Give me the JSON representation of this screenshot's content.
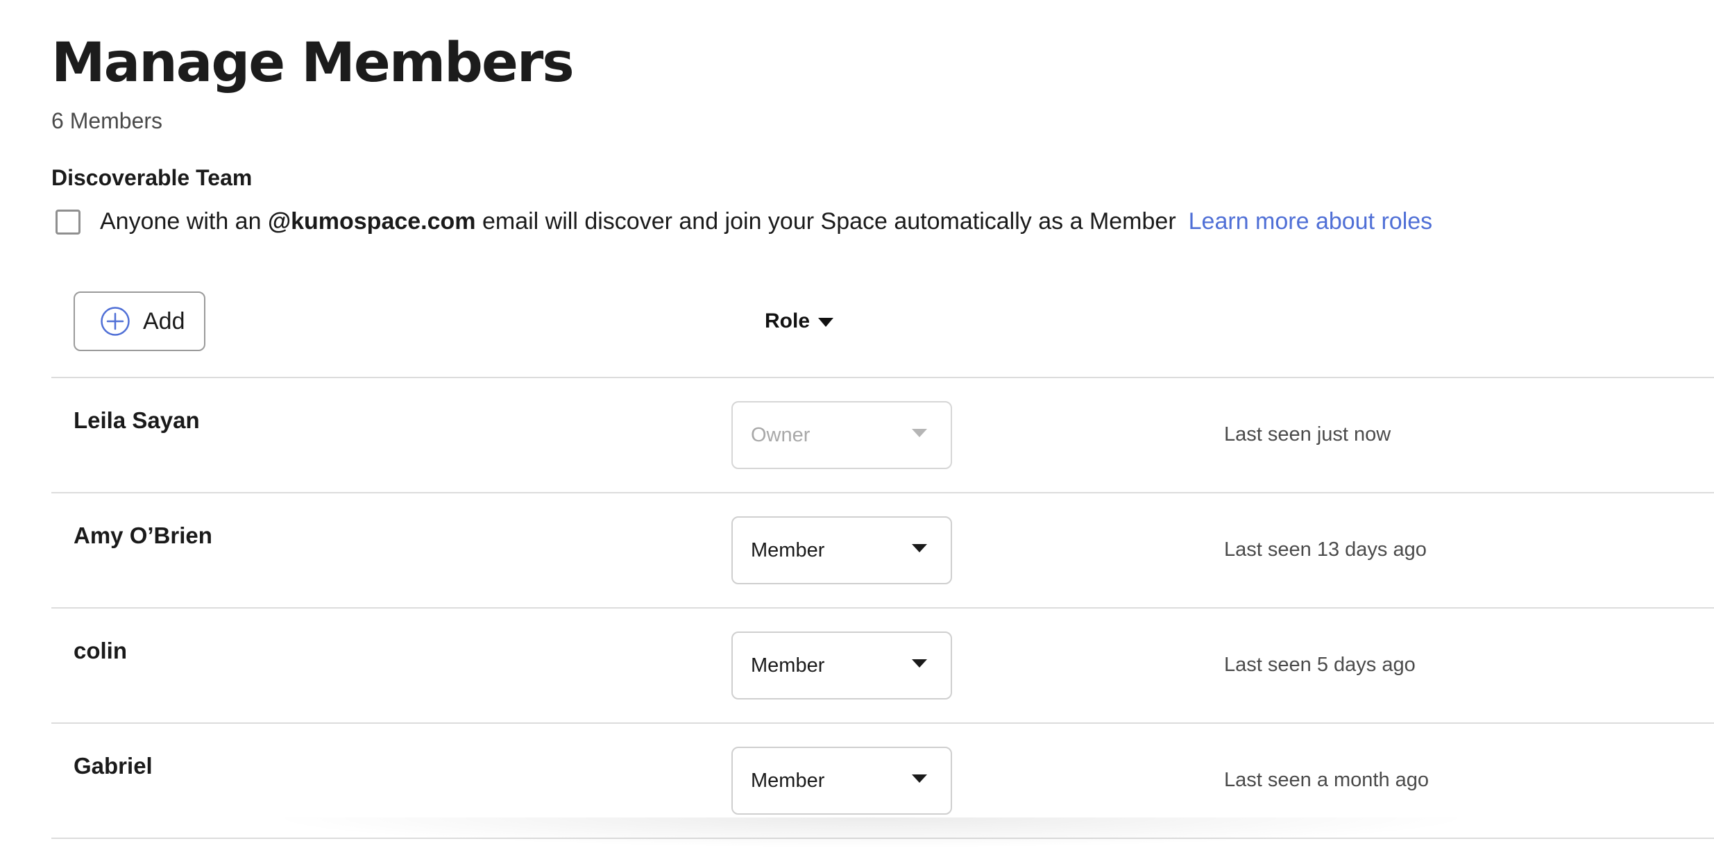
{
  "header": {
    "title": "Manage Members",
    "member_count": "6 Members"
  },
  "discoverable": {
    "heading": "Discoverable Team",
    "checked": false,
    "text_before": "Anyone with an ",
    "domain": "@kumospace.com",
    "text_after": " email will discover and join your Space automatically as a Member",
    "link_label": "Learn more about roles"
  },
  "toolbar": {
    "add_label": "Add",
    "add_icon": "plus-circle-icon",
    "role_column_label": "Role",
    "role_sort_icon": "caret-down-icon"
  },
  "colors": {
    "link": "#4f6fd6",
    "divider": "#dcdcdc",
    "disabled_text": "#a8a8a8"
  },
  "members": [
    {
      "name": "Leila Sayan",
      "role": "Owner",
      "role_disabled": true,
      "last_seen": "Last seen just now"
    },
    {
      "name": "Amy O’Brien",
      "role": "Member",
      "role_disabled": false,
      "last_seen": "Last seen 13 days ago"
    },
    {
      "name": "colin",
      "role": "Member",
      "role_disabled": false,
      "last_seen": "Last seen 5 days ago"
    },
    {
      "name": "Gabriel",
      "role": "Member",
      "role_disabled": false,
      "last_seen": "Last seen a month ago"
    }
  ]
}
